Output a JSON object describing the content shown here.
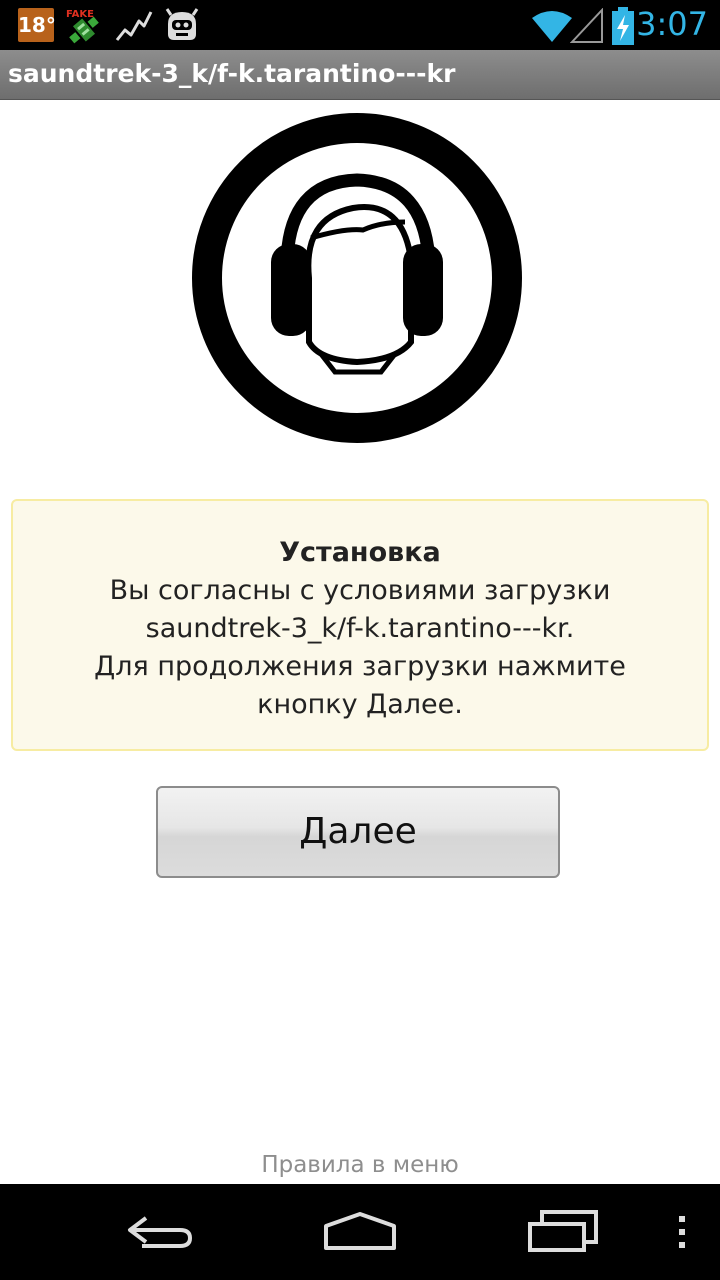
{
  "status_bar": {
    "temperature": "18°",
    "clock": "3:07",
    "icons": [
      "temperature-badge",
      "fake-gps-icon",
      "activity-icon",
      "cyanogenmod-icon",
      "wifi-icon",
      "signal-icon",
      "battery-charging-icon"
    ],
    "fake_label": "FAKE",
    "clock_color": "#33b5e5"
  },
  "title_bar": {
    "title": "saundtrek-3_k/f-k.tarantino---kr"
  },
  "notice": {
    "heading": "Установка",
    "lines": [
      "Вы согласны с условиями загрузки",
      "saundtrek-3_k/f-k.tarantino---kr.",
      "Для продолжения загрузки нажмите",
      "кнопку Далее."
    ]
  },
  "next_button": {
    "label": "Далее"
  },
  "footer": {
    "hint": "Правила в меню"
  },
  "nav_bar": {
    "icons": [
      "back-icon",
      "home-icon",
      "recent-apps-icon",
      "menu-icon"
    ]
  }
}
